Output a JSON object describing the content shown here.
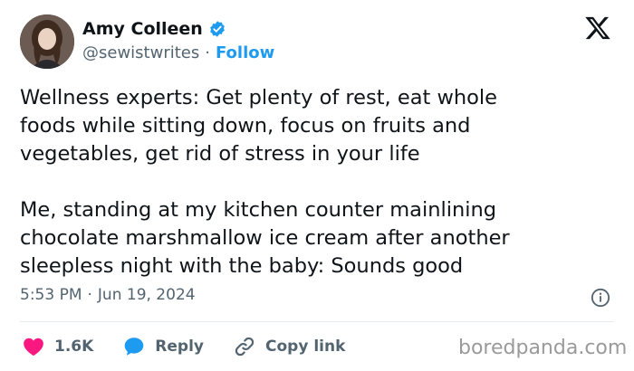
{
  "author": {
    "name": "Amy Colleen",
    "handle": "@sewistwrites",
    "separator": "·",
    "follow_label": "Follow",
    "verified_icon": "verified-badge-icon",
    "avatar_icon": "profile-photo"
  },
  "platform_logo": "x-logo-icon",
  "tweet": {
    "text": "Wellness experts: Get plenty of rest, eat whole\nfoods while sitting down, focus on fruits and\nvegetables, get rid of stress in your life\n\nMe, standing at my kitchen counter mainlining\nchocolate marshmallow ice cream after another\nsleepless night with the baby: Sounds good"
  },
  "meta": {
    "time": "5:53 PM",
    "separator": "·",
    "date": "Jun 19, 2024",
    "info_icon": "info-icon"
  },
  "actions": {
    "likes_count": "1.6K",
    "reply_label": "Reply",
    "copy_link_label": "Copy link"
  },
  "watermark": "boredpanda.com",
  "colors": {
    "accent": "#1d9bf0",
    "heart": "#f91880",
    "text": "#0f1419",
    "muted": "#536471"
  }
}
